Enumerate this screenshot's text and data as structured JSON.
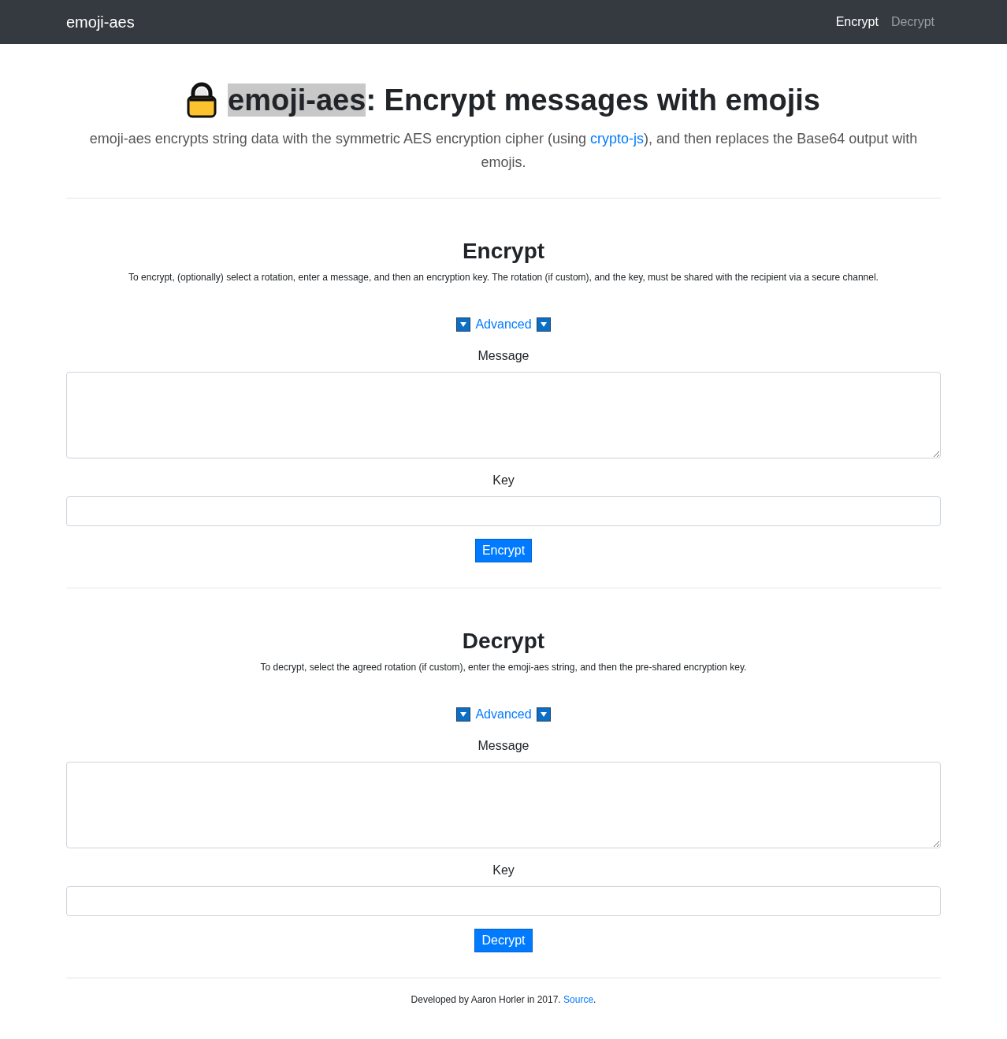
{
  "navbar": {
    "brand": "emoji-aes",
    "links": [
      {
        "label": "Encrypt",
        "selected": true
      },
      {
        "label": "Decrypt",
        "selected": false
      }
    ]
  },
  "header": {
    "title_parts": [
      {
        "text": "emoji-aes",
        "highlighted": true
      },
      {
        "text": ": Encrypt messages with emojis",
        "highlighted": false
      }
    ],
    "intro_parts": [
      {
        "kind": "text",
        "text": "emoji-aes encrypts string data with the symmetric AES encryption cipher (using "
      },
      {
        "kind": "link",
        "text": "crypto-js"
      },
      {
        "kind": "text",
        "text": "), and then replaces the Base64 output with emojis."
      }
    ]
  },
  "sections": [
    {
      "heading": "Encrypt",
      "description": "To encrypt, (optionally) select a rotation, enter a message, and then an encryption key. The rotation (if custom), and the key, must be shared with the recipient via a secure channel.",
      "advanced": "Advanced",
      "message_label": "Message",
      "key_label": "Key",
      "button": "Encrypt"
    },
    {
      "heading": "Decrypt",
      "description": "To decrypt, select the agreed rotation (if custom), enter the emoji-aes string, and then the pre-shared encryption key.",
      "advanced": "Advanced",
      "message_label": "Message",
      "key_label": "Key",
      "button": "Decrypt"
    }
  ],
  "footer": {
    "parts": [
      {
        "kind": "text",
        "text": "Developed by Aaron Horler in 2017. "
      },
      {
        "kind": "link",
        "text": "Source"
      },
      {
        "kind": "text",
        "text": "."
      }
    ]
  }
}
